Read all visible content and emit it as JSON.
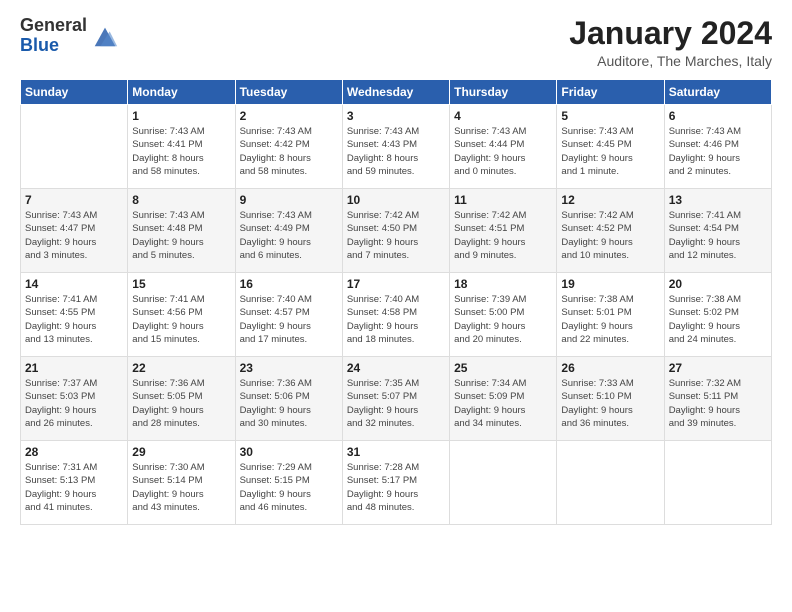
{
  "logo": {
    "general": "General",
    "blue": "Blue"
  },
  "header": {
    "month": "January 2024",
    "location": "Auditore, The Marches, Italy"
  },
  "days_of_week": [
    "Sunday",
    "Monday",
    "Tuesday",
    "Wednesday",
    "Thursday",
    "Friday",
    "Saturday"
  ],
  "weeks": [
    [
      {
        "day": "",
        "info": ""
      },
      {
        "day": "1",
        "info": "Sunrise: 7:43 AM\nSunset: 4:41 PM\nDaylight: 8 hours\nand 58 minutes."
      },
      {
        "day": "2",
        "info": "Sunrise: 7:43 AM\nSunset: 4:42 PM\nDaylight: 8 hours\nand 58 minutes."
      },
      {
        "day": "3",
        "info": "Sunrise: 7:43 AM\nSunset: 4:43 PM\nDaylight: 8 hours\nand 59 minutes."
      },
      {
        "day": "4",
        "info": "Sunrise: 7:43 AM\nSunset: 4:44 PM\nDaylight: 9 hours\nand 0 minutes."
      },
      {
        "day": "5",
        "info": "Sunrise: 7:43 AM\nSunset: 4:45 PM\nDaylight: 9 hours\nand 1 minute."
      },
      {
        "day": "6",
        "info": "Sunrise: 7:43 AM\nSunset: 4:46 PM\nDaylight: 9 hours\nand 2 minutes."
      }
    ],
    [
      {
        "day": "7",
        "info": "Sunrise: 7:43 AM\nSunset: 4:47 PM\nDaylight: 9 hours\nand 3 minutes."
      },
      {
        "day": "8",
        "info": "Sunrise: 7:43 AM\nSunset: 4:48 PM\nDaylight: 9 hours\nand 5 minutes."
      },
      {
        "day": "9",
        "info": "Sunrise: 7:43 AM\nSunset: 4:49 PM\nDaylight: 9 hours\nand 6 minutes."
      },
      {
        "day": "10",
        "info": "Sunrise: 7:42 AM\nSunset: 4:50 PM\nDaylight: 9 hours\nand 7 minutes."
      },
      {
        "day": "11",
        "info": "Sunrise: 7:42 AM\nSunset: 4:51 PM\nDaylight: 9 hours\nand 9 minutes."
      },
      {
        "day": "12",
        "info": "Sunrise: 7:42 AM\nSunset: 4:52 PM\nDaylight: 9 hours\nand 10 minutes."
      },
      {
        "day": "13",
        "info": "Sunrise: 7:41 AM\nSunset: 4:54 PM\nDaylight: 9 hours\nand 12 minutes."
      }
    ],
    [
      {
        "day": "14",
        "info": "Sunrise: 7:41 AM\nSunset: 4:55 PM\nDaylight: 9 hours\nand 13 minutes."
      },
      {
        "day": "15",
        "info": "Sunrise: 7:41 AM\nSunset: 4:56 PM\nDaylight: 9 hours\nand 15 minutes."
      },
      {
        "day": "16",
        "info": "Sunrise: 7:40 AM\nSunset: 4:57 PM\nDaylight: 9 hours\nand 17 minutes."
      },
      {
        "day": "17",
        "info": "Sunrise: 7:40 AM\nSunset: 4:58 PM\nDaylight: 9 hours\nand 18 minutes."
      },
      {
        "day": "18",
        "info": "Sunrise: 7:39 AM\nSunset: 5:00 PM\nDaylight: 9 hours\nand 20 minutes."
      },
      {
        "day": "19",
        "info": "Sunrise: 7:38 AM\nSunset: 5:01 PM\nDaylight: 9 hours\nand 22 minutes."
      },
      {
        "day": "20",
        "info": "Sunrise: 7:38 AM\nSunset: 5:02 PM\nDaylight: 9 hours\nand 24 minutes."
      }
    ],
    [
      {
        "day": "21",
        "info": "Sunrise: 7:37 AM\nSunset: 5:03 PM\nDaylight: 9 hours\nand 26 minutes."
      },
      {
        "day": "22",
        "info": "Sunrise: 7:36 AM\nSunset: 5:05 PM\nDaylight: 9 hours\nand 28 minutes."
      },
      {
        "day": "23",
        "info": "Sunrise: 7:36 AM\nSunset: 5:06 PM\nDaylight: 9 hours\nand 30 minutes."
      },
      {
        "day": "24",
        "info": "Sunrise: 7:35 AM\nSunset: 5:07 PM\nDaylight: 9 hours\nand 32 minutes."
      },
      {
        "day": "25",
        "info": "Sunrise: 7:34 AM\nSunset: 5:09 PM\nDaylight: 9 hours\nand 34 minutes."
      },
      {
        "day": "26",
        "info": "Sunrise: 7:33 AM\nSunset: 5:10 PM\nDaylight: 9 hours\nand 36 minutes."
      },
      {
        "day": "27",
        "info": "Sunrise: 7:32 AM\nSunset: 5:11 PM\nDaylight: 9 hours\nand 39 minutes."
      }
    ],
    [
      {
        "day": "28",
        "info": "Sunrise: 7:31 AM\nSunset: 5:13 PM\nDaylight: 9 hours\nand 41 minutes."
      },
      {
        "day": "29",
        "info": "Sunrise: 7:30 AM\nSunset: 5:14 PM\nDaylight: 9 hours\nand 43 minutes."
      },
      {
        "day": "30",
        "info": "Sunrise: 7:29 AM\nSunset: 5:15 PM\nDaylight: 9 hours\nand 46 minutes."
      },
      {
        "day": "31",
        "info": "Sunrise: 7:28 AM\nSunset: 5:17 PM\nDaylight: 9 hours\nand 48 minutes."
      },
      {
        "day": "",
        "info": ""
      },
      {
        "day": "",
        "info": ""
      },
      {
        "day": "",
        "info": ""
      }
    ]
  ]
}
